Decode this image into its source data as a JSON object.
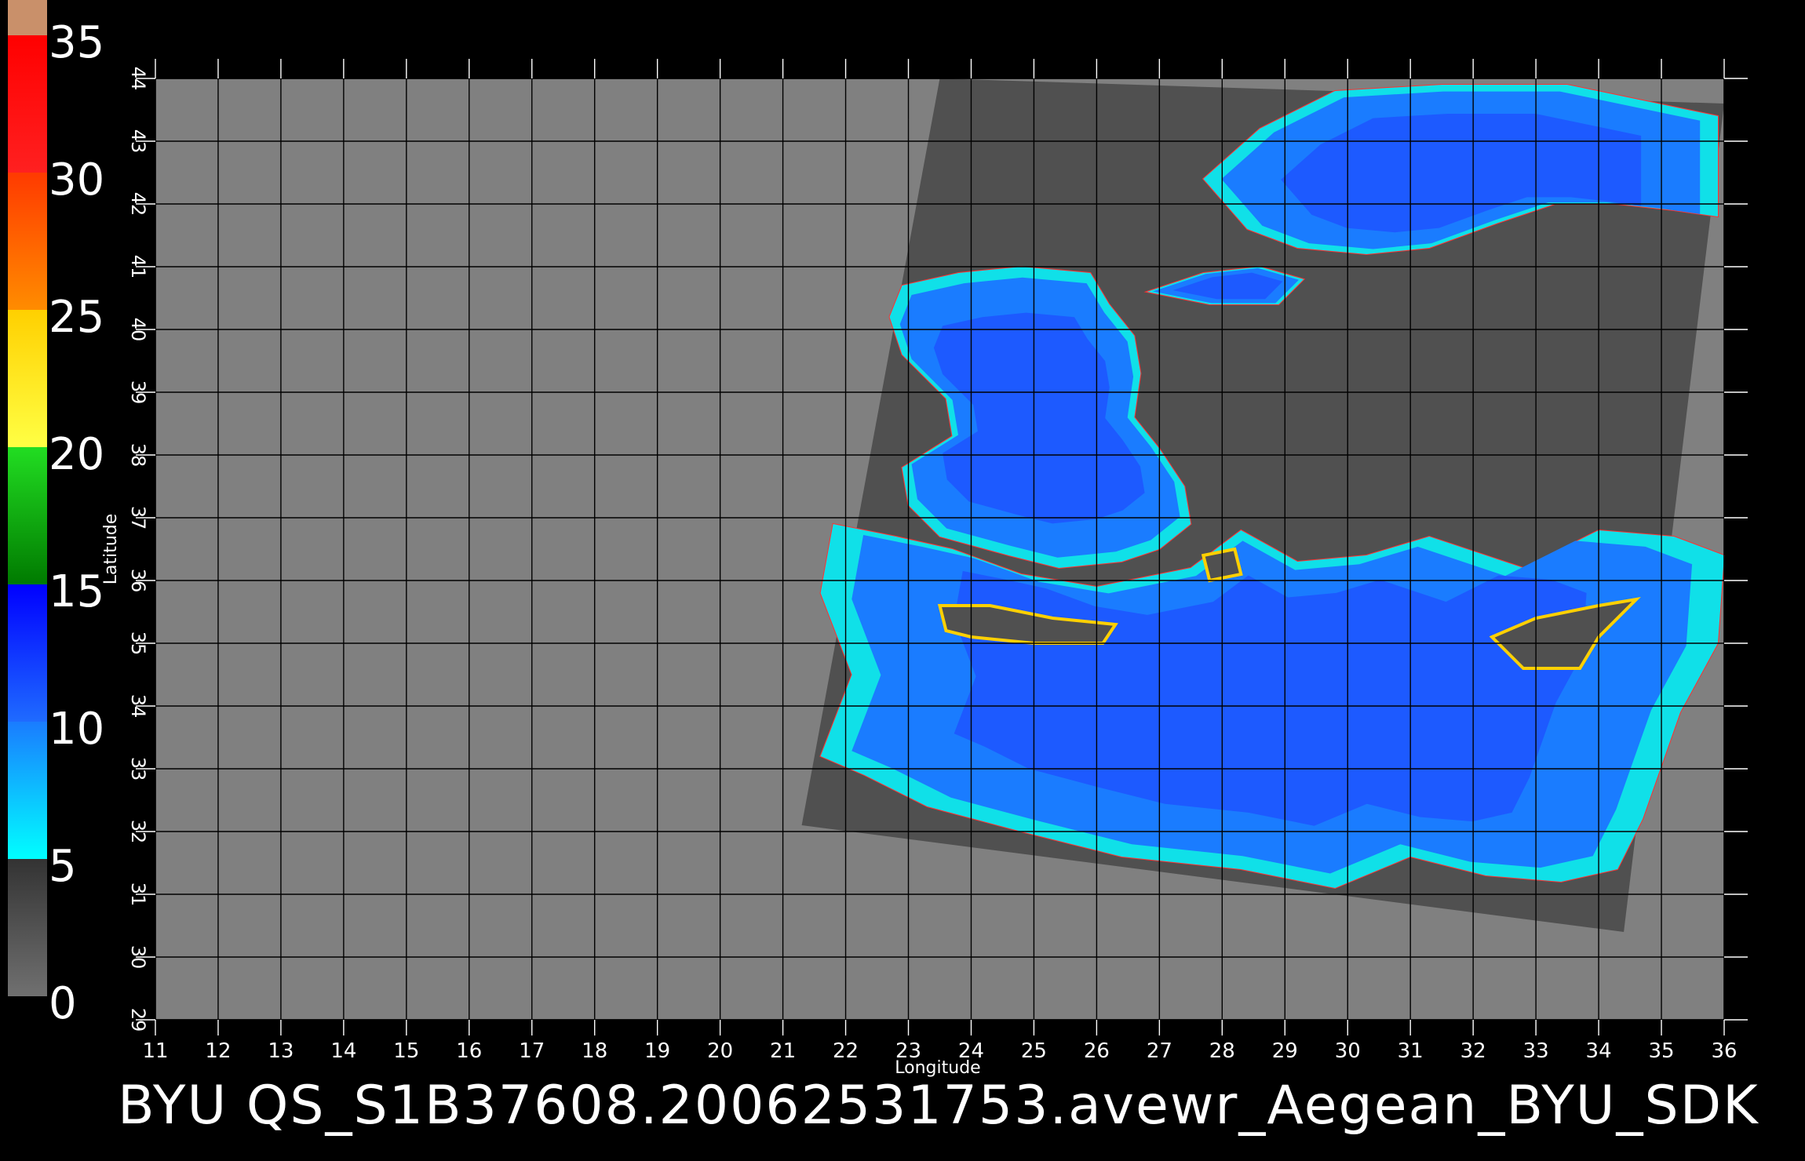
{
  "title": "BYU  QS_S1B37608.20062531753.avewr_Aegean_BYU_SDK",
  "axes": {
    "xlabel": "Longitude",
    "ylabel": "Latitude",
    "x_ticks": [
      "11",
      "12",
      "13",
      "14",
      "15",
      "16",
      "17",
      "18",
      "19",
      "20",
      "21",
      "22",
      "23",
      "24",
      "25",
      "26",
      "27",
      "28",
      "29",
      "30",
      "31",
      "32",
      "33",
      "34",
      "35",
      "36"
    ],
    "y_ticks": [
      "29",
      "30",
      "31",
      "32",
      "33",
      "34",
      "35",
      "36",
      "37",
      "38",
      "39",
      "40",
      "41",
      "42",
      "43",
      "44"
    ],
    "x_range": [
      11,
      36
    ],
    "y_range": [
      29,
      44
    ],
    "grid": true
  },
  "colorbar": {
    "labels": [
      "0",
      "5",
      "10",
      "15",
      "20",
      "25",
      "30",
      "35"
    ],
    "range": [
      0,
      35
    ],
    "segments": [
      {
        "from": 0,
        "to": 5,
        "colors": [
          "#707070",
          "#333333"
        ]
      },
      {
        "from": 5,
        "to": 10,
        "colors": [
          "#00ffff",
          "#1a7cff"
        ]
      },
      {
        "from": 10,
        "to": 15,
        "colors": [
          "#1f6bff",
          "#0000ff"
        ]
      },
      {
        "from": 15,
        "to": 20,
        "colors": [
          "#007a00",
          "#22dd22"
        ]
      },
      {
        "from": 20,
        "to": 25,
        "colors": [
          "#ffff44",
          "#ffd000"
        ]
      },
      {
        "from": 25,
        "to": 30,
        "colors": [
          "#ff8c00",
          "#ff3a00"
        ]
      },
      {
        "from": 30,
        "to": 35,
        "colors": [
          "#ff2020",
          "#ff0000"
        ]
      },
      {
        "from": 35,
        "to": 36,
        "colors": [
          "#c9906a",
          "#c9906a"
        ]
      }
    ]
  },
  "colors": {
    "background": "#000000",
    "no_data": "#808080",
    "land_in_swath": "#505050",
    "grid_line": "#000000",
    "axis_text": "#ffffff"
  },
  "swath_corners": [
    [
      23.5,
      44.0
    ],
    [
      36.0,
      43.6
    ],
    [
      34.4,
      30.4
    ],
    [
      21.3,
      32.1
    ]
  ],
  "sea_regions": [
    {
      "name": "black-sea",
      "points": [
        [
          27.7,
          42.4
        ],
        [
          28.6,
          43.2
        ],
        [
          29.8,
          43.8
        ],
        [
          31.5,
          43.9
        ],
        [
          33.5,
          43.9
        ],
        [
          35.9,
          43.4
        ],
        [
          35.9,
          41.8
        ],
        [
          35.2,
          41.9
        ],
        [
          34.3,
          42.0
        ],
        [
          33.3,
          42.0
        ],
        [
          32.4,
          41.7
        ],
        [
          31.3,
          41.3
        ],
        [
          30.3,
          41.2
        ],
        [
          29.2,
          41.3
        ],
        [
          28.4,
          41.6
        ]
      ]
    },
    {
      "name": "aegean-sea",
      "points": [
        [
          22.9,
          40.7
        ],
        [
          23.8,
          40.9
        ],
        [
          24.8,
          41.0
        ],
        [
          25.9,
          40.9
        ],
        [
          26.2,
          40.4
        ],
        [
          26.6,
          39.9
        ],
        [
          26.7,
          39.3
        ],
        [
          26.6,
          38.6
        ],
        [
          27.0,
          38.1
        ],
        [
          27.4,
          37.5
        ],
        [
          27.5,
          36.9
        ],
        [
          27.0,
          36.5
        ],
        [
          26.4,
          36.3
        ],
        [
          25.4,
          36.2
        ],
        [
          24.6,
          36.4
        ],
        [
          23.5,
          36.7
        ],
        [
          23.0,
          37.2
        ],
        [
          22.9,
          37.8
        ],
        [
          23.7,
          38.3
        ],
        [
          23.6,
          38.9
        ],
        [
          22.9,
          39.6
        ],
        [
          22.7,
          40.2
        ]
      ]
    },
    {
      "name": "marmara-sea",
      "points": [
        [
          26.8,
          40.6
        ],
        [
          27.7,
          40.9
        ],
        [
          28.6,
          41.0
        ],
        [
          29.3,
          40.8
        ],
        [
          28.9,
          40.4
        ],
        [
          27.8,
          40.4
        ]
      ]
    },
    {
      "name": "eastern-mediterranean",
      "points": [
        [
          21.8,
          36.9
        ],
        [
          22.8,
          36.7
        ],
        [
          23.7,
          36.5
        ],
        [
          24.8,
          36.1
        ],
        [
          26.0,
          35.9
        ],
        [
          27.5,
          36.2
        ],
        [
          28.3,
          36.8
        ],
        [
          29.2,
          36.3
        ],
        [
          30.3,
          36.4
        ],
        [
          31.3,
          36.7
        ],
        [
          32.8,
          36.2
        ],
        [
          34.0,
          36.8
        ],
        [
          35.2,
          36.7
        ],
        [
          36.0,
          36.4
        ],
        [
          35.9,
          35.0
        ],
        [
          35.3,
          33.9
        ],
        [
          34.7,
          32.2
        ],
        [
          34.3,
          31.4
        ],
        [
          33.4,
          31.2
        ],
        [
          32.2,
          31.3
        ],
        [
          31.0,
          31.6
        ],
        [
          29.8,
          31.1
        ],
        [
          28.3,
          31.4
        ],
        [
          26.4,
          31.6
        ],
        [
          24.8,
          32.0
        ],
        [
          23.3,
          32.4
        ],
        [
          22.3,
          32.9
        ],
        [
          21.6,
          33.2
        ],
        [
          22.1,
          34.5
        ],
        [
          21.6,
          35.8
        ]
      ]
    }
  ],
  "islands": [
    {
      "name": "crete",
      "points": [
        [
          23.5,
          35.6
        ],
        [
          24.3,
          35.6
        ],
        [
          25.3,
          35.4
        ],
        [
          26.3,
          35.3
        ],
        [
          26.1,
          35.0
        ],
        [
          25.0,
          35.0
        ],
        [
          24.0,
          35.1
        ],
        [
          23.6,
          35.2
        ]
      ]
    },
    {
      "name": "cyprus",
      "points": [
        [
          32.3,
          35.1
        ],
        [
          33.0,
          35.4
        ],
        [
          34.0,
          35.6
        ],
        [
          34.6,
          35.7
        ],
        [
          34.0,
          35.1
        ],
        [
          33.7,
          34.6
        ],
        [
          32.8,
          34.6
        ]
      ]
    },
    {
      "name": "rhodes",
      "points": [
        [
          27.7,
          36.4
        ],
        [
          28.2,
          36.5
        ],
        [
          28.3,
          36.1
        ],
        [
          27.8,
          36.0
        ]
      ]
    }
  ]
}
